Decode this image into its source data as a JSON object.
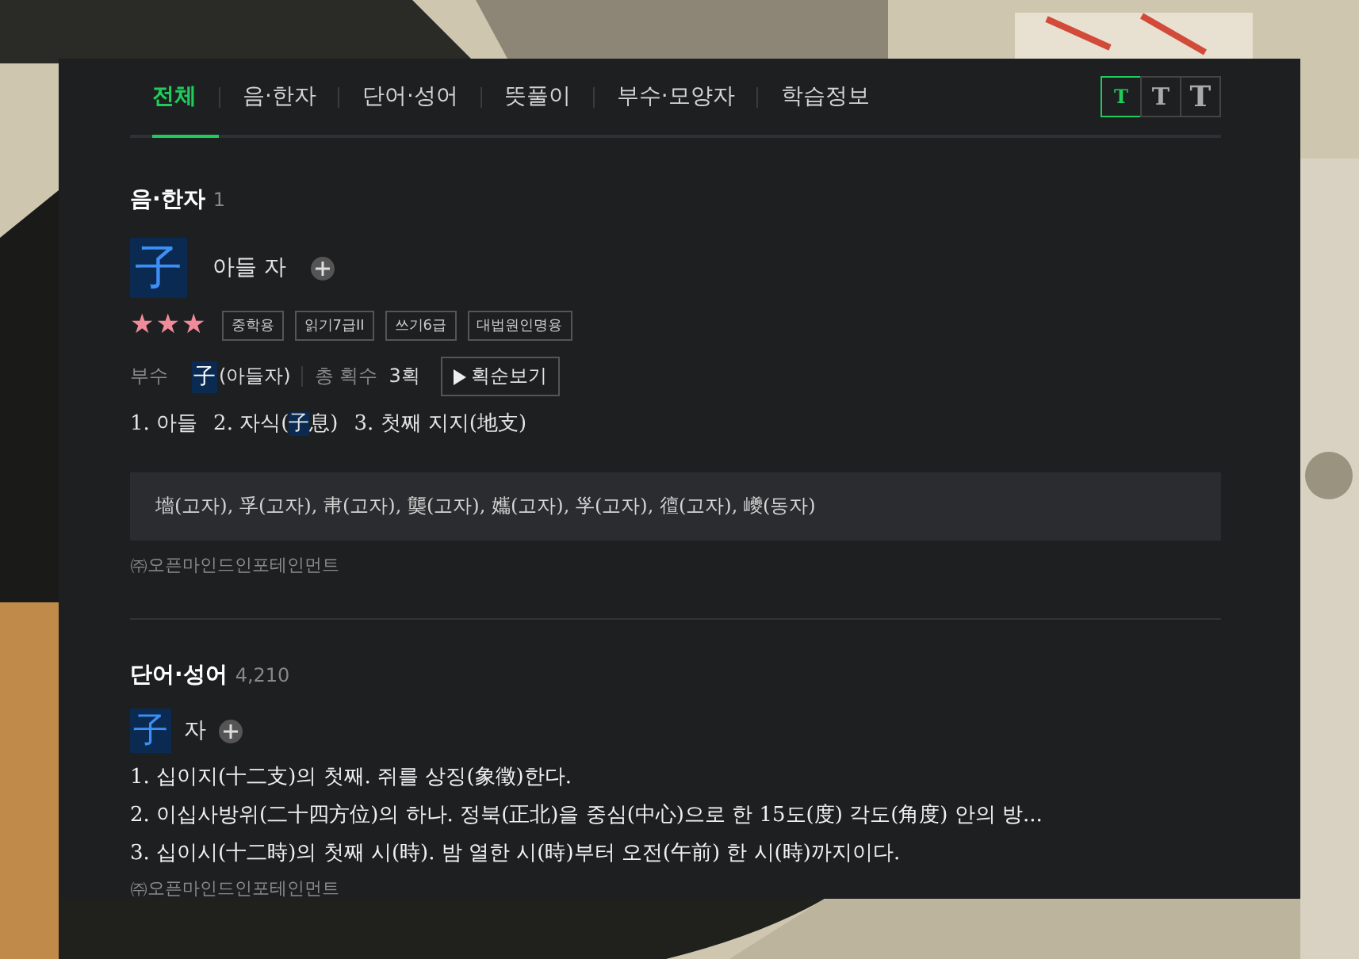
{
  "tabs": [
    {
      "label": "전체",
      "selected": true
    },
    {
      "label": "음·한자",
      "selected": false
    },
    {
      "label": "단어·성어",
      "selected": false
    },
    {
      "label": "뜻풀이",
      "selected": false
    },
    {
      "label": "부수·모양자",
      "selected": false
    },
    {
      "label": "학습정보",
      "selected": false
    }
  ],
  "font_sizes": [
    {
      "label": "T",
      "selected": true
    },
    {
      "label": "T",
      "selected": false
    },
    {
      "label": "T",
      "selected": false
    }
  ],
  "hanja_section": {
    "title": "음·한자",
    "count": "1",
    "hanja": "子",
    "reading": "아들 자",
    "stars": 3,
    "tags": [
      "중학용",
      "읽기7급II",
      "쓰기6급",
      "대법원인명용"
    ],
    "radical_label": "부수",
    "radical": "子",
    "radical_reading": "(아들자)",
    "strokes_label": "총 획수",
    "strokes": "3획",
    "stroke_button": "획순보기",
    "meanings": [
      {
        "number": "1.",
        "parts": [
          {
            "text": "아들",
            "highlight": false
          }
        ]
      },
      {
        "number": "2.",
        "parts": [
          {
            "text": "자식(",
            "highlight": false
          },
          {
            "text": "子",
            "highlight": true
          },
          {
            "text": "息)",
            "highlight": false
          }
        ]
      },
      {
        "number": "3.",
        "parts": [
          {
            "text": "첫째 지지(地支)",
            "highlight": false
          }
        ]
      }
    ],
    "variants": "墻(고자), 孚(고자), 帇(고자), 龑(고자), 孈(고자), 㜽(고자), 㣶(고자), 巙(동자)",
    "source": "㈜오픈마인드인포테인먼트"
  },
  "word_section": {
    "title": "단어·성어",
    "count": "4,210",
    "hanja": "子",
    "reading": "자",
    "meanings": [
      "1. 십이지(十二支)의 첫째. 쥐를 상징(象徵)한다.",
      "2. 이십사방위(二十四方位)의 하나. 정북(正北)을 중심(中心)으로 한 15도(度) 각도(角度) 안의 방...",
      "3. 십이시(十二時)의 첫째 시(時). 밤 열한 시(時)부터 오전(午前) 한 시(時)까지이다."
    ],
    "source": "㈜오픈마인드인포테인먼트"
  }
}
